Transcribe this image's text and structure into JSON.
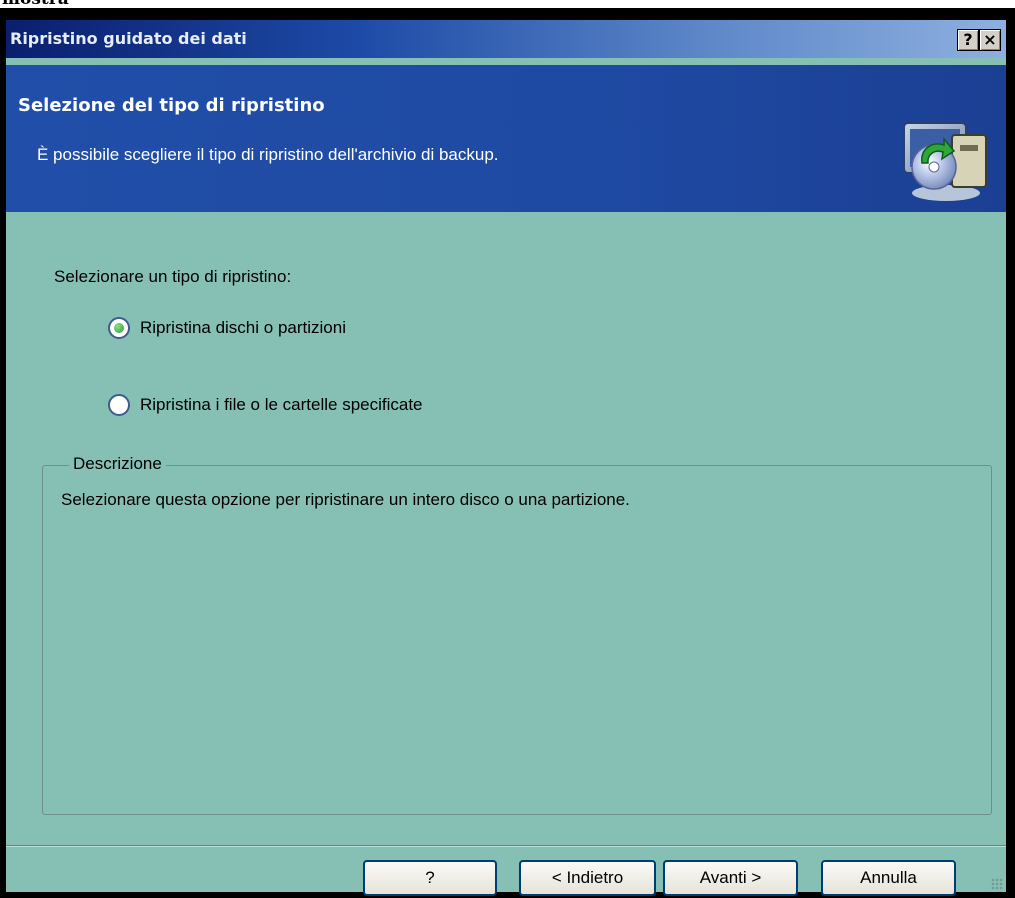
{
  "page": {
    "header_text": "mostra"
  },
  "titlebar": {
    "title": "Ripristino guidato dei dati",
    "help_label": "?",
    "close_label": "×"
  },
  "header": {
    "title": "Selezione del tipo di ripristino",
    "subtitle": "È possibile scegliere il tipo di ripristino dell'archivio di backup.",
    "icon": "restore-disk-icon"
  },
  "content": {
    "prompt": "Selezionare un tipo di ripristino:",
    "options": [
      {
        "label": "Ripristina dischi o partizioni",
        "selected": true
      },
      {
        "label": "Ripristina i file o le cartelle specificate",
        "selected": false
      }
    ]
  },
  "description": {
    "legend": "Descrizione",
    "text": "Selezionare questa opzione per ripristinare un intero disco o una partizione."
  },
  "buttons": {
    "help": "?",
    "back": "< Indietro",
    "next": "Avanti >",
    "cancel": "Annulla"
  },
  "colors": {
    "titlebar_start": "#0a1f6e",
    "header_bg": "#204ea8",
    "dialog_bg": "#86bfb4",
    "radio_selected": "#2a9a2a"
  }
}
